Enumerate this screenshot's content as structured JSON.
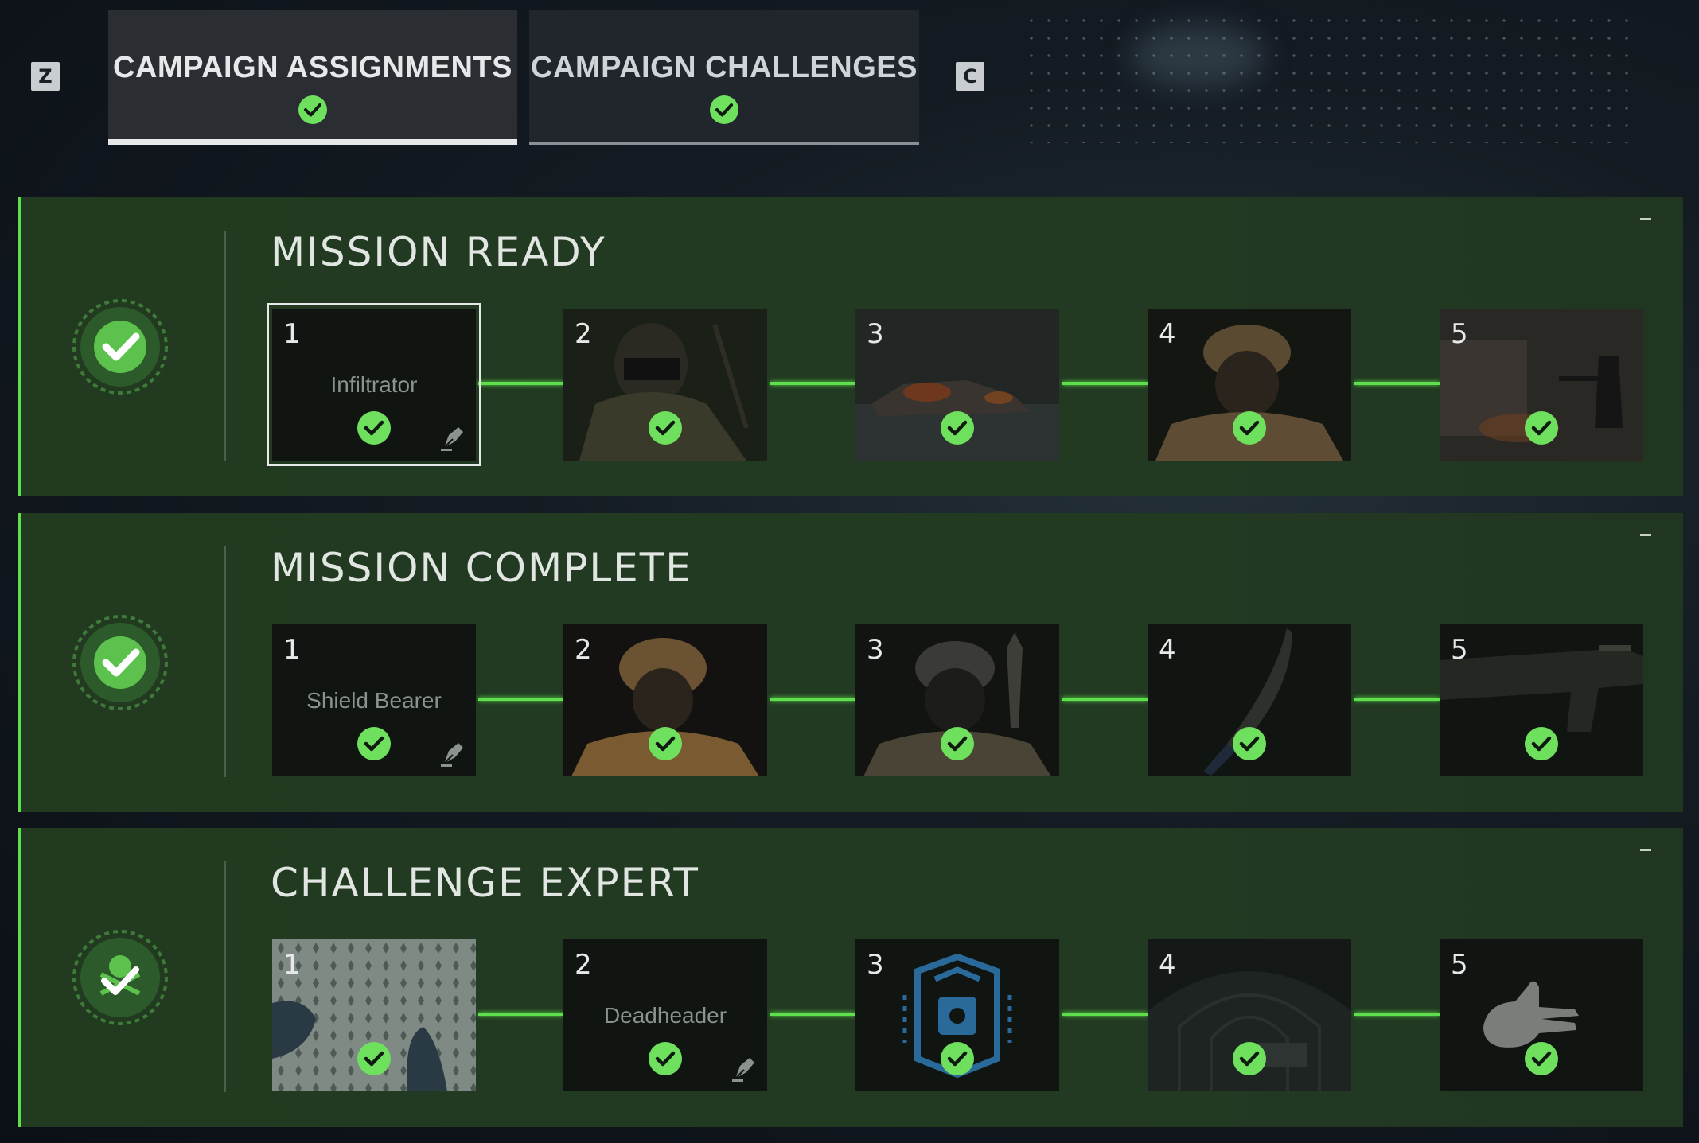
{
  "keys": {
    "prev": "Z",
    "next": "C"
  },
  "tabs": [
    {
      "label": "CAMPAIGN ASSIGNMENTS",
      "complete": true,
      "active": true
    },
    {
      "label": "CAMPAIGN CHALLENGES",
      "complete": true,
      "active": false
    }
  ],
  "colors": {
    "accent": "#5ee04d",
    "panel": "#233a22",
    "check": "#6fe05e"
  },
  "sections": [
    {
      "title": "MISSION READY",
      "badge_icon": "star-check-badge-icon",
      "cards": [
        {
          "num": "1",
          "name": "Infiltrator",
          "art": "none",
          "has_pen": true,
          "selected": true
        },
        {
          "num": "2",
          "name": "",
          "art": "soldier-camo-icon"
        },
        {
          "num": "3",
          "name": "",
          "art": "burning-ship-icon"
        },
        {
          "num": "4",
          "name": "",
          "art": "soldier-helmet-icon"
        },
        {
          "num": "5",
          "name": "",
          "art": "soldier-aiming-icon"
        }
      ]
    },
    {
      "title": "MISSION COMPLETE",
      "badge_icon": "star-check-badge-icon",
      "cards": [
        {
          "num": "1",
          "name": "Shield Bearer",
          "art": "none",
          "has_pen": true
        },
        {
          "num": "2",
          "name": "",
          "art": "soldier-helmet-icon"
        },
        {
          "num": "3",
          "name": "",
          "art": "soldier-rocket-icon"
        },
        {
          "num": "4",
          "name": "",
          "art": "knife-icon"
        },
        {
          "num": "5",
          "name": "",
          "art": "rifle-icon"
        }
      ]
    },
    {
      "title": "CHALLENGE EXPERT",
      "badge_icon": "skull-check-badge-icon",
      "cards": [
        {
          "num": "1",
          "name": "",
          "art": "camo-pattern-icon"
        },
        {
          "num": "2",
          "name": "Deadheader",
          "art": "none",
          "has_pen": true
        },
        {
          "num": "3",
          "name": "",
          "art": "emblem-icon"
        },
        {
          "num": "4",
          "name": "",
          "art": "tunnel-icon"
        },
        {
          "num": "5",
          "name": "",
          "art": "hand-gesture-icon"
        }
      ]
    }
  ]
}
